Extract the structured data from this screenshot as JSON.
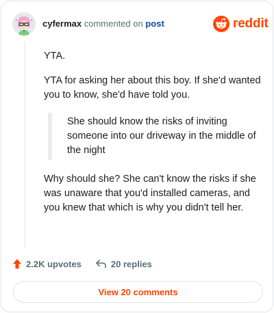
{
  "header": {
    "username": "cyfermax",
    "action_text": "commented on",
    "target_text": "post"
  },
  "brand": {
    "name": "reddit",
    "icon": "reddit-logo-icon",
    "color": "#ff4500"
  },
  "comment": {
    "paragraph_1": "YTA.",
    "paragraph_2": "YTA for asking her about this boy. If she'd wanted you to know, she'd have told you.",
    "quote": "She should know the risks of inviting someone into our driveway in the middle of the night",
    "paragraph_3": "Why should she? She can't know the risks if she was unaware that you'd installed cameras, and you knew that which is why you didn't tell her."
  },
  "actions": {
    "upvotes_label": "2.2K upvotes",
    "upvote_icon": "upvote-arrow-icon",
    "replies_label": "20 replies",
    "reply_icon": "reply-arrow-icon"
  },
  "footer": {
    "view_comments_label": "View 20 comments"
  },
  "colors": {
    "accent": "#ff4500",
    "link": "#0a4aa8",
    "muted": "#576f76"
  }
}
